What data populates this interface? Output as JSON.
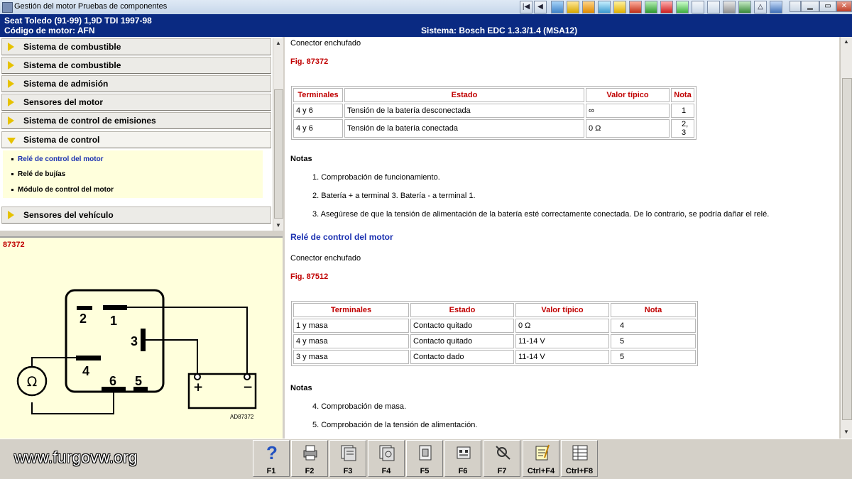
{
  "window": {
    "title": "Gestión del motor Pruebas de componentes",
    "toolbar_icons": [
      "first-page-icon",
      "prev-page-icon",
      "diagram-icon",
      "tools-icon",
      "engine-icon",
      "filter-icon",
      "warning-icon",
      "component-icon",
      "gauge-icon",
      "car-icon",
      "parts-icon",
      "print-icon",
      "book-icon",
      "settings-icon",
      "info-icon",
      "network-icon",
      "view-icon"
    ]
  },
  "header": {
    "vehicle": "Seat   Toledo (91-99) 1,9D TDI 1997-98",
    "engine_code": "Código de motor: AFN",
    "system": "Sistema: Bosch EDC 1.3.3/1.4 (MSA12)"
  },
  "tree": {
    "categories": [
      {
        "label": "Sistema de combustible"
      },
      {
        "label": "Sistema de combustible"
      },
      {
        "label": "Sistema de admisión"
      },
      {
        "label": "Sensores del motor"
      },
      {
        "label": "Sistema de control de emisiones"
      },
      {
        "label": "Sistema de control"
      }
    ],
    "subitems": [
      {
        "label": "Relé de control del motor",
        "color": "#1a30b0"
      },
      {
        "label": "Relé de bujías",
        "color": "#000000"
      },
      {
        "label": "Módulo de control del motor",
        "color": "#000000"
      }
    ],
    "last_category": "Sensores del vehículo"
  },
  "figure": {
    "label": "87372",
    "pins": [
      "1",
      "2",
      "3",
      "4",
      "5",
      "6"
    ],
    "plus": "+",
    "minus": "−",
    "omega": "Ω",
    "code": "AD87372"
  },
  "content": {
    "line1": "Conector enchufado",
    "fig1": "Fig. 87372",
    "table1": {
      "headers": [
        "Terminales",
        "Estado",
        "Valor típico",
        "Nota"
      ],
      "rows": [
        [
          "4 y 6",
          "Tensión de la batería desconectada",
          "∞",
          "1"
        ],
        [
          "4 y 6",
          "Tensión de la batería conectada",
          "0 Ω",
          "2, 3"
        ]
      ]
    },
    "notes1_title": "Notas",
    "notes1": [
      "1. Comprobación de funcionamiento.",
      "2. Batería + a terminal 3. Batería - a terminal 1.",
      "3. Asegúrese de que la tensión de alimentación de la batería esté correctamente conectada. De lo contrario, se podría dañar el relé."
    ],
    "section2": "Relé de control del motor",
    "line2": "Conector enchufado",
    "fig2": "Fig. 87512",
    "table2": {
      "headers": [
        "Terminales",
        "Estado",
        "Valor típico",
        "Nota"
      ],
      "rows": [
        [
          "1 y masa",
          "Contacto quitado",
          "0 Ω",
          "4"
        ],
        [
          "4 y masa",
          "Contacto quitado",
          "11-14 V",
          "5"
        ],
        [
          "3 y masa",
          "Contacto dado",
          "11-14 V",
          "5"
        ]
      ]
    },
    "notes2_title": "Notas",
    "notes2": [
      "4. Comprobación de masa.",
      "5. Comprobación de la tensión de alimentación."
    ]
  },
  "bottom": {
    "url": "www.furgovw.org",
    "fkeys": [
      {
        "label": "F1",
        "icon": "help-icon"
      },
      {
        "label": "F2",
        "icon": "print-icon"
      },
      {
        "label": "F3",
        "icon": "diagram-icon"
      },
      {
        "label": "F4",
        "icon": "diagram-zoom-icon"
      },
      {
        "label": "F5",
        "icon": "component-icon"
      },
      {
        "label": "F6",
        "icon": "connector-icon"
      },
      {
        "label": "F7",
        "icon": "probe-icon"
      },
      {
        "label": "Ctrl+F4",
        "icon": "notes-icon"
      },
      {
        "label": "Ctrl+F8",
        "icon": "table-icon"
      }
    ]
  }
}
